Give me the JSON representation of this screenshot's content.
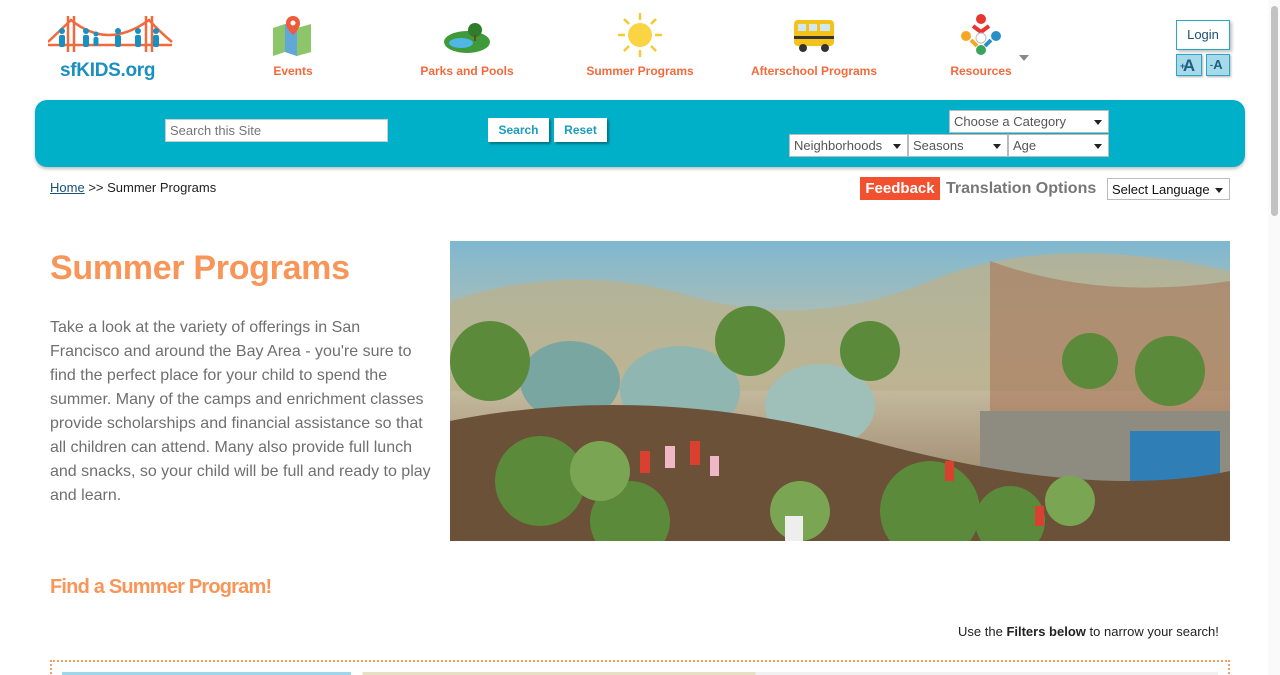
{
  "site": {
    "logo_text": "sfKIDS.org"
  },
  "nav": {
    "items": [
      {
        "label": "Events",
        "icon": "map-pin-icon"
      },
      {
        "label": "Parks and Pools",
        "icon": "park-pool-icon"
      },
      {
        "label": "Summer Programs",
        "icon": "sun-icon"
      },
      {
        "label": "Afterschool Programs",
        "icon": "school-bus-icon"
      },
      {
        "label": "Resources",
        "icon": "people-cluster-icon"
      }
    ]
  },
  "account": {
    "login_label": "Login",
    "font_increase_label": "A",
    "font_decrease_label": "A"
  },
  "search": {
    "placeholder": "Search this Site",
    "search_label": "Search",
    "reset_label": "Reset",
    "category_selected": "Choose a Category",
    "neighborhoods_selected": "Neighborhoods",
    "seasons_selected": "Seasons",
    "age_selected": "Age"
  },
  "breadcrumb": {
    "home": "Home",
    "separator": ">>",
    "current": "Summer Programs"
  },
  "tools": {
    "feedback_label": "Feedback",
    "translation_label": "Translation Options",
    "language_selected": "Select Language"
  },
  "main": {
    "title": "Summer Programs",
    "intro": "Take a look at the variety of offerings in San Francisco and around the Bay Area - you're sure to find the perfect place for your child to spend the summer. Many of the camps and enrichment classes provide scholarships and financial assistance so that all children can attend. Many also provide full lunch and snacks, so your child will be full and ready to play and learn.",
    "find_heading": "Find a Summer Program!",
    "filter_note_prefix": "Use the",
    "filter_note_bold": "Filters below",
    "filter_note_suffix": "to narrow your search!"
  },
  "colors": {
    "brand_orange": "#f79658",
    "nav_orange": "#f26a3c",
    "search_bar_teal": "#00b0c8",
    "feedback_red": "#f2502f",
    "logo_blue": "#1a8fc2"
  }
}
